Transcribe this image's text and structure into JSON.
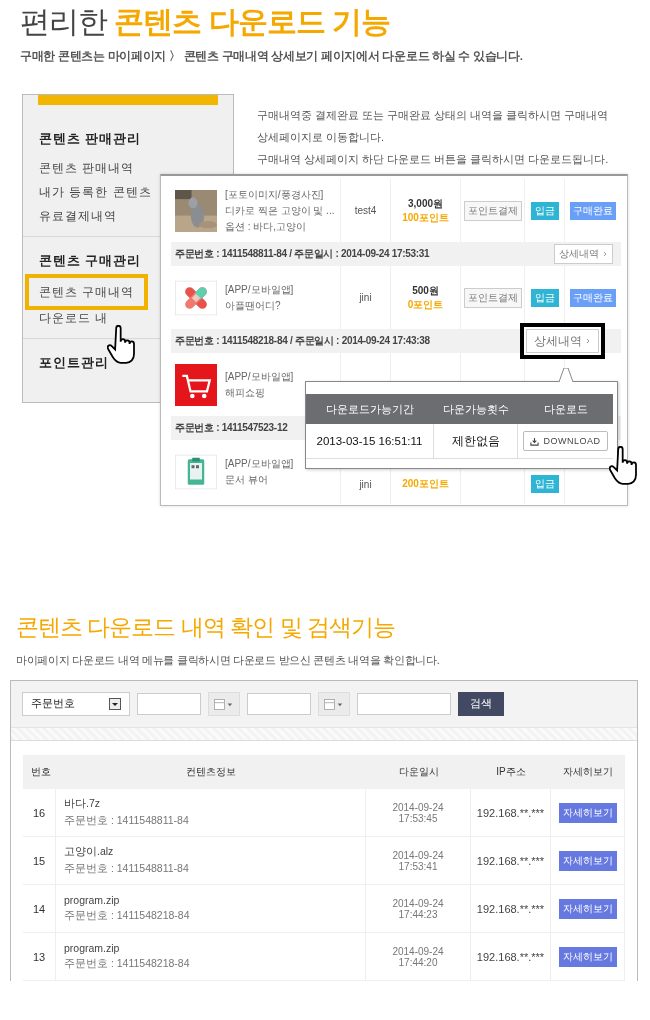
{
  "header": {
    "title": "편리한 **콘텐츠 다운로드 기능**",
    "subtitle": "구매한 콘텐츠는 마이페이지 〉 콘텐츠 구매내역 상세보기 페이지에서 다운로드 하실 수 있습니다."
  },
  "sidebar": {
    "sections": [
      {
        "title": "콘텐츠 판매관리",
        "items": [
          {
            "label": "콘텐츠 판매내역",
            "selected": false
          },
          {
            "label": "내가 등록한 콘텐츠",
            "selected": false
          },
          {
            "label": "유료결제내역",
            "selected": false
          }
        ]
      },
      {
        "title": "콘텐츠 구매관리",
        "items": [
          {
            "label": "콘텐츠 구매내역",
            "selected": true
          },
          {
            "label": "다운로드 내",
            "selected": false
          }
        ]
      },
      {
        "title": "포인트관리"
      }
    ]
  },
  "description": [
    "구매내역중 결제완료 또는 구매완료 상태의 내역을 클릭하시면 구매내역 상세페이지로 이동합니다.",
    "구매내역 상세페이지 하단 다운로드 버튼을 클릭하시면 다운로드됩니다."
  ],
  "orders": [
    {
      "product": {
        "category": "[포토이미지/풍경사진]",
        "title": "디카로 찍은 고양이 및 ...",
        "option": "옵션 : 바다,고양이",
        "seller": "test4",
        "price": "3,000원",
        "points": "100포인트",
        "payment": "포인트결제",
        "deposit": "입금",
        "status": "구매완료"
      },
      "order_info": "주문번호 : 1411548811-84 / 주문일시 : 2014-09-24 17:53:31",
      "detail_button": {
        "label": "상세내역",
        "highlighted": false
      }
    },
    {
      "product": {
        "kind": "bandage",
        "category": "[APP/모바일앱]",
        "title": "아플땐어디?",
        "seller": "jini",
        "price": "500원",
        "points": "0포인트",
        "payment": "포인트결제",
        "deposit": "입금",
        "status": "구매완료"
      },
      "order_info": "주문번호 : 1411548218-84 / 주문일시 : 2014-09-24 17:43:38",
      "detail_button": {
        "label": "상세내역",
        "highlighted": true
      }
    },
    {
      "product": {
        "kind": "cart",
        "category": "[APP/모바일앱]",
        "title": "해피쇼핑"
      },
      "order_info": "주문번호 : 1411547523-12"
    },
    {
      "product": {
        "kind": "clipboard",
        "category": "[APP/모바일앱]",
        "title": "문서 뷰어",
        "seller": "jini",
        "points": "200포인트",
        "deposit": "입금"
      }
    }
  ],
  "download_popup": {
    "columns": [
      "다운로드가능기간",
      "다운가능횟수",
      "다운로드"
    ],
    "rows": [
      {
        "period": "2013-03-15 16:51:11",
        "count": "제한없음",
        "button": "DOWNLOAD"
      }
    ]
  },
  "section2": {
    "title": "콘텐츠 다운로드 내역 확인 및 검색기능",
    "subtitle": "마이페이지 다운로드 내역 메뉴를 클릭하시면 다운로드 받으신 콘텐츠 내역을 확인합니다.",
    "search": {
      "select": "주문번호",
      "button": "검색"
    },
    "columns": [
      "번호",
      "컨텐츠정보",
      "다운일시",
      "IP주소",
      "자세히보기"
    ],
    "rows": [
      {
        "no": "16",
        "file": "바다.7z",
        "order": "주문번호 : 1411548811-84",
        "date": "2014-09-24",
        "time": "17:53:45",
        "ip": "192.168.**.***",
        "button": "자세히보기"
      },
      {
        "no": "15",
        "file": "고양이.alz",
        "order": "주문번호 : 1411548811-84",
        "date": "2014-09-24",
        "time": "17:53:41",
        "ip": "192.168.**.***",
        "button": "자세히보기"
      },
      {
        "no": "14",
        "file": "program.zip",
        "order": "주문번호 : 1411548218-84",
        "date": "2014-09-24",
        "time": "17:44:23",
        "ip": "192.168.**.***",
        "button": "자세히보기"
      },
      {
        "no": "13",
        "file": "program.zip",
        "order": "주문번호 : 1411548218-84",
        "date": "2014-09-24",
        "time": "17:44:20",
        "ip": "192.168.**.***",
        "button": "자세히보기"
      }
    ]
  }
}
